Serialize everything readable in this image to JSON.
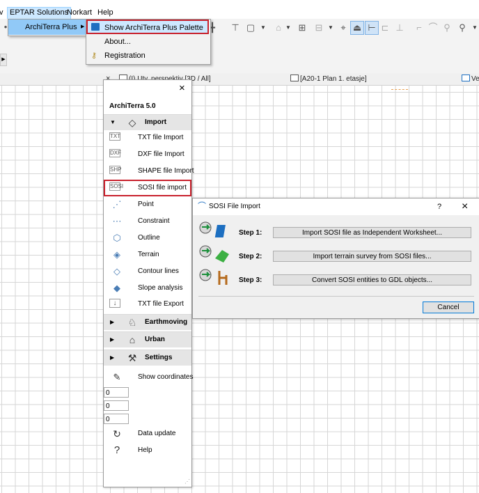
{
  "menubar": {
    "items": [
      {
        "label": "v"
      },
      {
        "label": "EPTAR Solutions"
      },
      {
        "label": "Norkart"
      },
      {
        "label": "Help"
      }
    ]
  },
  "eptar_menu": {
    "items": [
      {
        "label": "ArchiTerra Plus",
        "has_submenu": true
      }
    ]
  },
  "architerra_submenu": {
    "items": [
      {
        "label": "Show ArchiTerra Plus Palette",
        "icon": "palette-icon",
        "highlighted": true
      },
      {
        "label": "About..."
      },
      {
        "label": "Registration",
        "icon": "key-icon"
      }
    ]
  },
  "tabs": [
    {
      "label": "(I) Utv. perspektiv [3D / All]"
    },
    {
      "label": "[A20-1 Plan 1. etasje]"
    },
    {
      "label": "Ve"
    }
  ],
  "palette": {
    "title": "ArchiTerra 5.0",
    "close_label": "×",
    "import_section": {
      "label": "Import",
      "expanded": true
    },
    "import_items": [
      {
        "label": "TXT file Import",
        "icon": "txt-import-icon"
      },
      {
        "label": "DXF file Import",
        "icon": "dxf-import-icon"
      },
      {
        "label": "SHAPE file Import",
        "icon": "shape-import-icon"
      },
      {
        "label": "SOSI file import",
        "icon": "sosi-import-icon",
        "highlighted": true
      },
      {
        "label": "Point",
        "icon": "point-icon"
      },
      {
        "label": "Constraint",
        "icon": "constraint-icon"
      },
      {
        "label": "Outline",
        "icon": "outline-icon"
      },
      {
        "label": "Terrain",
        "icon": "terrain-icon"
      },
      {
        "label": "Contour lines",
        "icon": "contour-lines-icon"
      },
      {
        "label": "Slope analysis",
        "icon": "slope-analysis-icon"
      },
      {
        "label": "TXT file Export",
        "icon": "txt-export-icon"
      }
    ],
    "sections": [
      {
        "label": "Earthmoving",
        "icon": "earthmoving-icon"
      },
      {
        "label": "Urban",
        "icon": "urban-icon"
      },
      {
        "label": "Settings",
        "icon": "settings-icon"
      }
    ],
    "show_coordinates": "Show coordinates",
    "coordinates": [
      "0",
      "0",
      "0"
    ],
    "data_update": "Data update",
    "help": "Help"
  },
  "dialog": {
    "title": "SOSI File Import",
    "help_label": "?",
    "close_label": "×",
    "steps": [
      {
        "label": "Step 1:",
        "button": "Import SOSI file as Independent Worksheet..."
      },
      {
        "label": "Step 2:",
        "button": "Import terrain survey from SOSI files..."
      },
      {
        "label": "Step 3:",
        "button": "Convert SOSI entities to GDL objects..."
      }
    ],
    "cancel_label": "Cancel"
  },
  "colors": {
    "highlight_border": "#c8202c",
    "menu_highlight": "#cde8ff",
    "accent_blue": "#1d6fc1"
  }
}
